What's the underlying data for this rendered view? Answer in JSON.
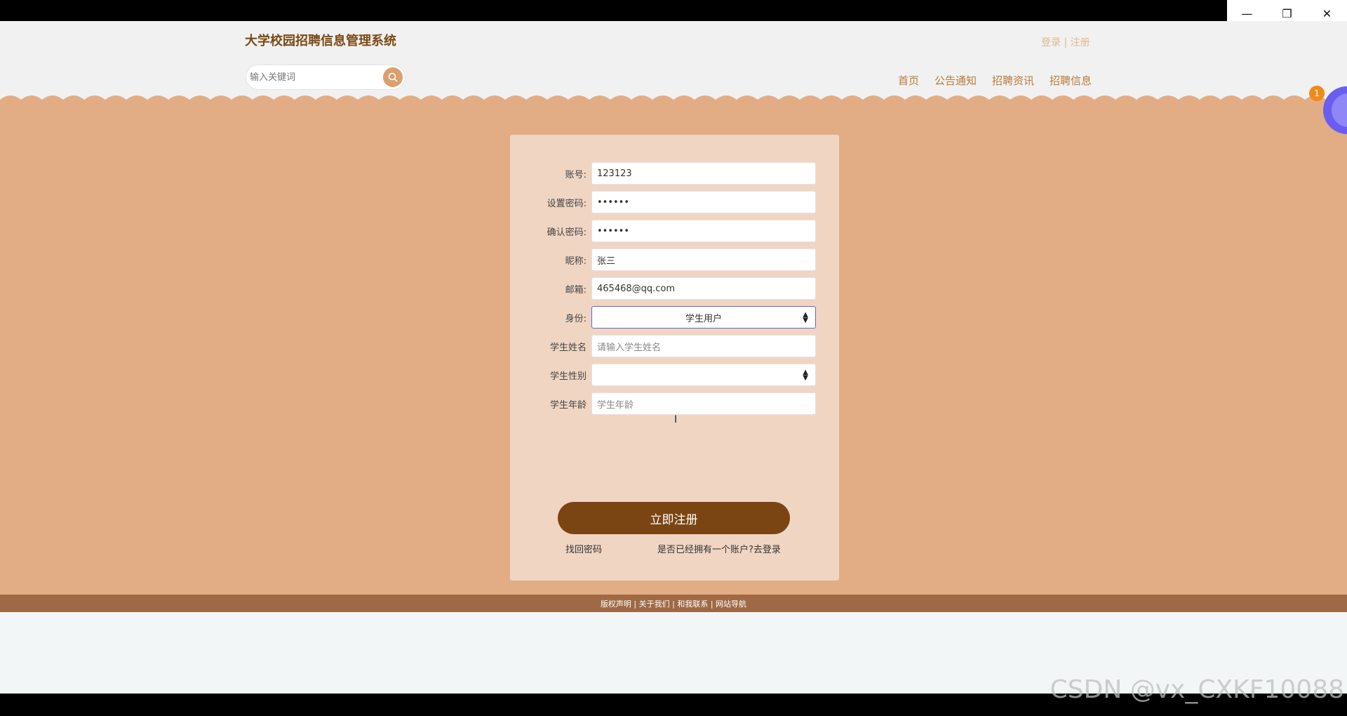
{
  "window": {
    "minimize_icon": "minimize-icon",
    "restore_icon": "restore-icon",
    "close_icon": "close-icon"
  },
  "header": {
    "brand": "大学校园招聘信息管理系统",
    "search_placeholder": "输入关键词",
    "login": "登录",
    "separator": " | ",
    "register": "注册",
    "nav": [
      "首页",
      "公告通知",
      "招聘资讯",
      "招聘信息"
    ]
  },
  "form": {
    "fields": [
      {
        "label": "账号:",
        "value": "123123"
      },
      {
        "label": "设置密码:",
        "value": "••••••"
      },
      {
        "label": "确认密码:",
        "value": "••••••"
      },
      {
        "label": "昵称:",
        "value": "张三"
      },
      {
        "label": "邮箱:",
        "value": "465468@qq.com"
      },
      {
        "label": "身份:",
        "value": "学生用户"
      },
      {
        "label": "学生姓名",
        "placeholder": "请输入学生姓名"
      },
      {
        "label": "学生性别",
        "value": ""
      },
      {
        "label": "学生年龄",
        "placeholder": "学生年龄"
      }
    ],
    "submit": "立即注册",
    "forgot": "找回密码",
    "has_account": "是否已经拥有一个账户?去登录"
  },
  "footer": {
    "links": "版权声明 | 关于我们 | 和我联系 | 网站导航"
  },
  "badge": "1",
  "watermark": "CSDN @vx_CXKF10088",
  "colors": {
    "brand": "#7a4a15",
    "nav": "#b87a3d",
    "main_bg": "#e2ad85",
    "panel_bg": "#f0d5c3",
    "submit_bg": "#7b4513",
    "footer_bg": "#9e6944"
  }
}
